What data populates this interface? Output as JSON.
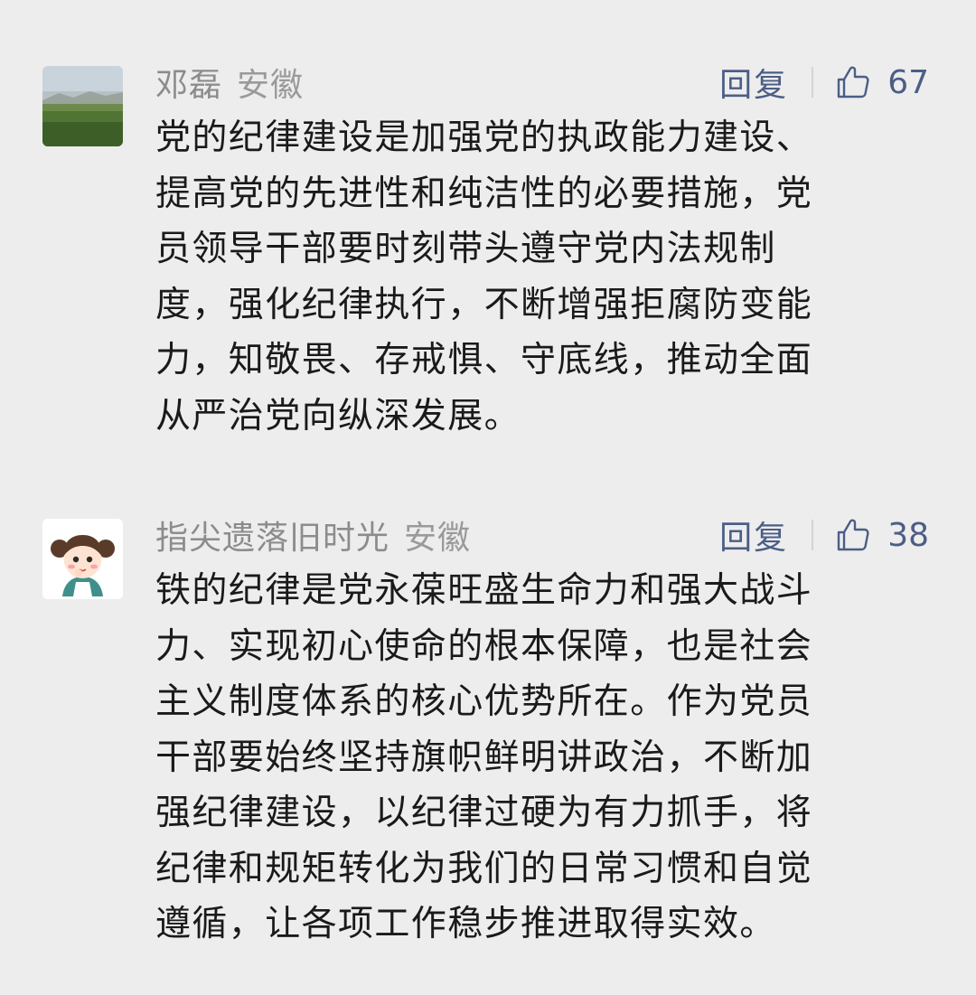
{
  "comments": [
    {
      "author": "邓磊",
      "region": "安徽",
      "reply_label": "回复",
      "likes": "67",
      "avatar_icon": "landscape-avatar",
      "lines": [
        "党的纪律建设是加强党的执政能力建设、",
        "提高党的先进性和纯洁性的必要措施，党",
        "员领导干部要时刻带头遵守党内法规制",
        "度，强化纪律执行，不断增强拒腐防变能",
        "力，知敬畏、存戒惧、守底线，推动全面",
        "从严治党向纵深发展。"
      ]
    },
    {
      "author": "指尖遗落旧时光",
      "region": "安徽",
      "reply_label": "回复",
      "likes": "38",
      "avatar_icon": "cartoon-girl-avatar",
      "lines": [
        "铁的纪律是党永葆旺盛生命力和强大战斗",
        "力、实现初心使命的根本保障，也是社会",
        "主义制度体系的核心优势所在。作为党员",
        "干部要始终坚持旗帜鲜明讲政治，不断加",
        "强纪律建设，以纪律过硬为有力抓手，将",
        "纪律和规矩转化为我们的日常习惯和自觉",
        "遵循，让各项工作稳步推进取得实效。"
      ]
    }
  ],
  "colors": {
    "background": "#ededed",
    "name_gray": "#8c8c8c",
    "link_blue": "#4c5e86",
    "text": "#1a1a1a"
  }
}
